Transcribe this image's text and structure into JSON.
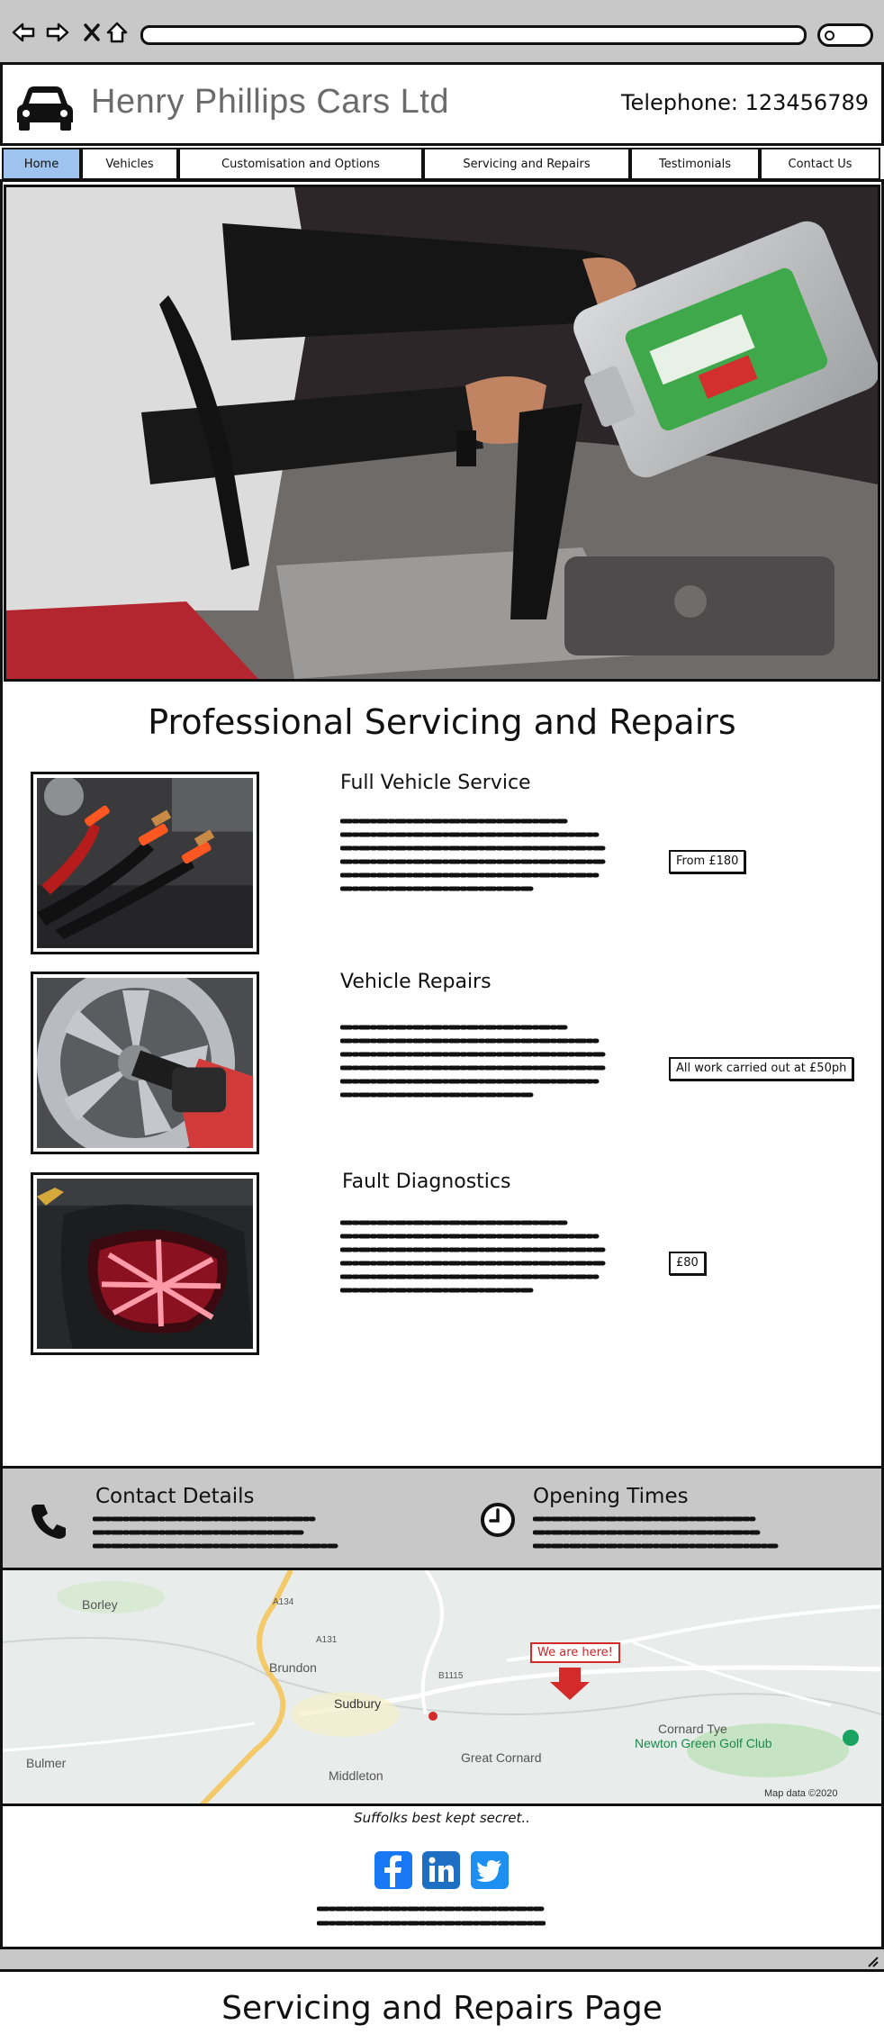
{
  "browser": {
    "icons": [
      "back-icon",
      "forward-icon",
      "close-icon",
      "home-icon",
      "search-icon"
    ]
  },
  "header": {
    "logo_icon": "car-icon",
    "title": "Henry Phillips Cars Ltd",
    "telephone": "Telephone: 123456789"
  },
  "nav": {
    "tabs": [
      {
        "label": "Home",
        "active": true
      },
      {
        "label": "Vehicles",
        "active": false
      },
      {
        "label": "Customisation and Options",
        "active": false
      },
      {
        "label": "Servicing and Repairs",
        "active": false
      },
      {
        "label": "Testimonials",
        "active": false
      },
      {
        "label": "Contact Us",
        "active": false
      }
    ]
  },
  "main": {
    "heading": "Professional Servicing and Repairs",
    "services": [
      {
        "title": "Full Vehicle Service",
        "price": "From £180",
        "image_icon": "jump-leads-image"
      },
      {
        "title": "Vehicle Repairs",
        "price": "All work carried out at £50ph",
        "image_icon": "wheel-wrench-image"
      },
      {
        "title": "Fault Diagnostics",
        "price": "£80",
        "image_icon": "tail-light-image"
      }
    ]
  },
  "footer": {
    "contact_title": "Contact Details",
    "contact_icon": "phone-icon",
    "hours_title": "Opening Times",
    "hours_icon": "clock-icon",
    "map": {
      "marker_label": "We are here!",
      "places": [
        "Borley",
        "Brundon",
        "Sudbury",
        "Bulmer",
        "Middleton",
        "Great Cornard",
        "Cornard Tye",
        "Newton Green Golf Club"
      ],
      "roads": [
        "A134",
        "A131",
        "B1115"
      ],
      "attribution": "Map data ©2020"
    },
    "tagline": "Suffolks best kept secret..",
    "social_icons": [
      "facebook-icon",
      "linkedin-icon",
      "twitter-icon"
    ]
  },
  "caption": "Servicing and Repairs Page",
  "colors": {
    "chrome": "#c8c8c8",
    "active_tab": "#9ec3ef",
    "title_grey": "#6b6b6b",
    "facebook": "#1877f2",
    "linkedin": "#1e6fc4",
    "twitter": "#1d8ff0",
    "marker": "#d32a2a"
  }
}
